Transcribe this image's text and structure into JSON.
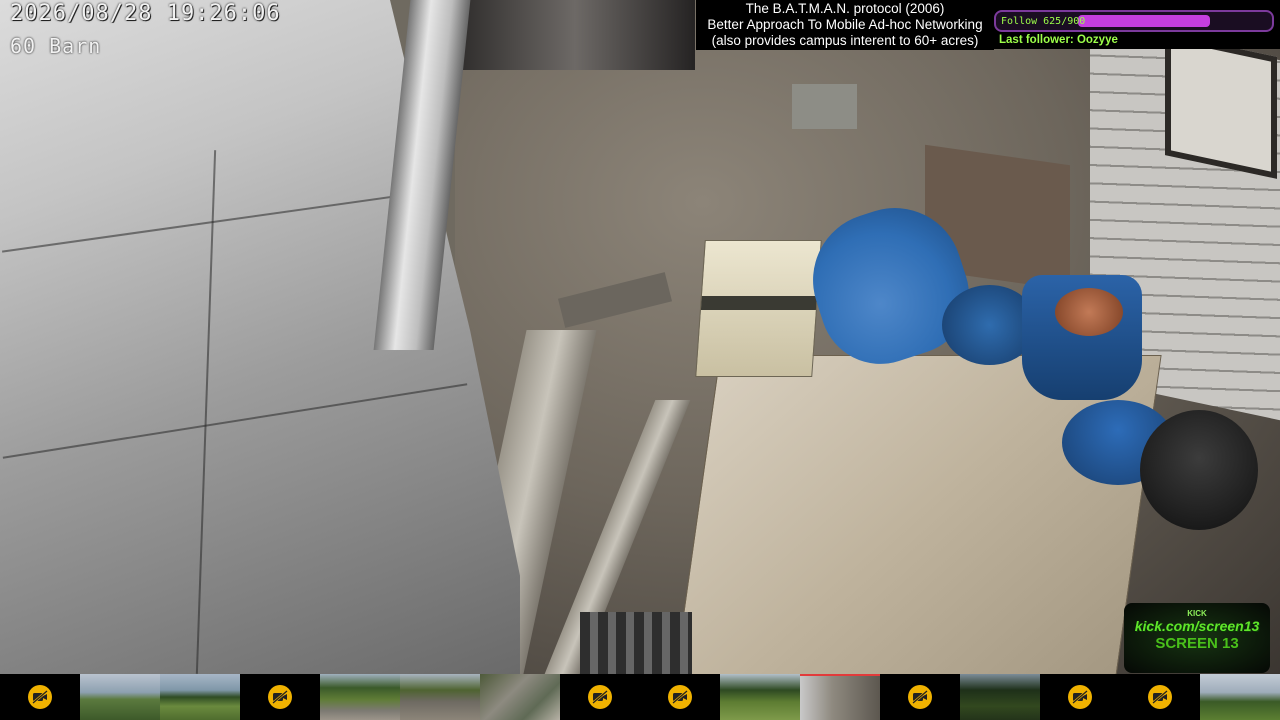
{
  "overlay": {
    "timestamp": "2026/08/28 19:26:06",
    "camera_name": "60 Barn"
  },
  "info_box": {
    "line1": "The B.A.T.M.A.N. protocol (2006)",
    "line2": "Better Approach To Mobile Ad-hoc Networking",
    "line3": "(also provides campus interent to 60+ acres)"
  },
  "follow_goal": {
    "label": "Follow 625/900",
    "current": 625,
    "target": 900,
    "bar_color": "#c53ee0",
    "text_color": "#9dff4a",
    "last_follower_label": "Last follower: Oozyye"
  },
  "kick_logo": {
    "top_text": "KICK",
    "url": "kick.com/screen13",
    "brand": "SCREEN 13",
    "color": "#5fe52a"
  },
  "camera_strip": [
    {
      "state": "off",
      "icon": "camera-off-icon"
    },
    {
      "state": "feed",
      "scene": "field-sky"
    },
    {
      "state": "feed",
      "scene": "field-trees"
    },
    {
      "state": "off",
      "icon": "camera-off-icon"
    },
    {
      "state": "feed",
      "scene": "trees-road"
    },
    {
      "state": "feed",
      "scene": "yard-junk"
    },
    {
      "state": "feed",
      "scene": "scrap-metal"
    },
    {
      "state": "off",
      "icon": "camera-off-icon"
    },
    {
      "state": "off",
      "icon": "camera-off-icon"
    },
    {
      "state": "feed",
      "scene": "lawn-trees"
    },
    {
      "state": "feed",
      "scene": "barn-interior",
      "active": true
    },
    {
      "state": "off",
      "icon": "camera-off-icon"
    },
    {
      "state": "feed",
      "scene": "dark-trees"
    },
    {
      "state": "off",
      "icon": "camera-off-icon"
    },
    {
      "state": "off",
      "icon": "camera-off-icon"
    },
    {
      "state": "feed",
      "scene": "field-horizon"
    }
  ]
}
